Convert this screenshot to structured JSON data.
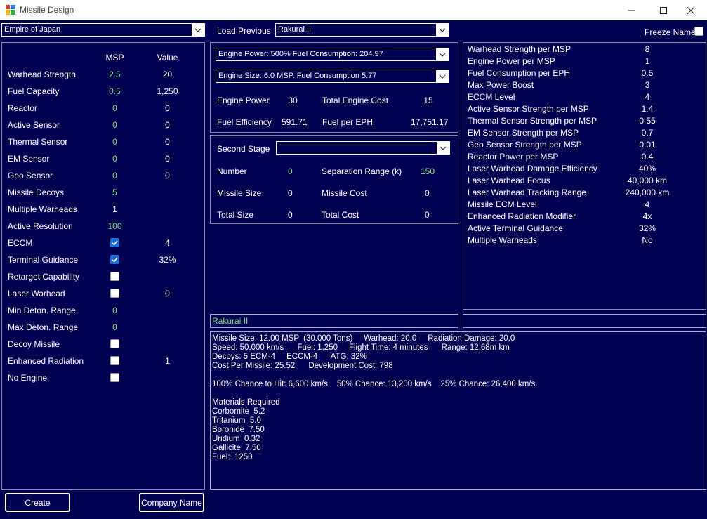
{
  "window": {
    "title": "Missile Design"
  },
  "top": {
    "empire": "Empire of Japan",
    "load_previous_label": "Load Previous",
    "load_previous_value": "Rakurai II",
    "freeze_name_label": "Freeze Name"
  },
  "left": {
    "col_msp": "MSP",
    "col_value": "Value",
    "rows": [
      {
        "label": "Warhead Strength",
        "msp": "2.5",
        "value": "20",
        "type": "num"
      },
      {
        "label": "Fuel Capacity",
        "msp": "0.5",
        "value": "1,250",
        "type": "num"
      },
      {
        "label": "Reactor",
        "msp": "0",
        "value": "0",
        "type": "num"
      },
      {
        "label": "Active Sensor",
        "msp": "0",
        "value": "0",
        "type": "num"
      },
      {
        "label": "Thermal Sensor",
        "msp": "0",
        "value": "0",
        "type": "num"
      },
      {
        "label": "EM Sensor",
        "msp": "0",
        "value": "0",
        "type": "num"
      },
      {
        "label": "Geo Sensor",
        "msp": "0",
        "value": "0",
        "type": "num"
      },
      {
        "label": "Missile Decoys",
        "msp": "5",
        "value": "",
        "type": "num"
      },
      {
        "label": "Multiple Warheads",
        "msp": "1",
        "value": "",
        "type": "white"
      },
      {
        "label": "Active Resolution",
        "msp": "100",
        "value": "",
        "type": "num"
      },
      {
        "label": "ECCM",
        "msp": "",
        "value": "4",
        "type": "check",
        "checked": true
      },
      {
        "label": "Terminal Guidance",
        "msp": "",
        "value": "32%",
        "type": "check",
        "checked": true
      },
      {
        "label": "Retarget Capability",
        "msp": "",
        "value": "",
        "type": "check",
        "checked": false
      },
      {
        "label": "Laser Warhead",
        "msp": "",
        "value": "0",
        "type": "check",
        "checked": false
      },
      {
        "label": "Min Deton. Range",
        "msp": "0",
        "value": "",
        "type": "num"
      },
      {
        "label": "Max Deton. Range",
        "msp": "0",
        "value": "",
        "type": "num"
      },
      {
        "label": "Decoy Missile",
        "msp": "",
        "value": "",
        "type": "check",
        "checked": false
      },
      {
        "label": "Enhanced Radiation",
        "msp": "",
        "value": "1",
        "type": "check",
        "checked": false
      },
      {
        "label": "No Engine",
        "msp": "",
        "value": "",
        "type": "check",
        "checked": false
      }
    ]
  },
  "engine": {
    "power_dropdown": "Engine Power: 500%    Fuel Consumption: 204.97",
    "size_dropdown": "Engine Size: 6.0 MSP.   Fuel Consumption 5.77",
    "engine_power_label": "Engine Power",
    "engine_power_value": "30",
    "total_engine_cost_label": "Total Engine Cost",
    "total_engine_cost_value": "15",
    "fuel_efficiency_label": "Fuel Efficiency",
    "fuel_efficiency_value": "591.71",
    "fuel_per_eph_label": "Fuel per EPH",
    "fuel_per_eph_value": "17,751.17"
  },
  "stage": {
    "second_stage_label": "Second Stage",
    "second_stage_value": "",
    "number_label": "Number",
    "number_value": "0",
    "separation_label": "Separation Range (k)",
    "separation_value": "150",
    "missile_size_label": "Missile Size",
    "missile_size_value": "0",
    "missile_cost_label": "Missile Cost",
    "missile_cost_value": "0",
    "total_size_label": "Total Size",
    "total_size_value": "0",
    "total_cost_label": "Total Cost",
    "total_cost_value": "0"
  },
  "tech": [
    {
      "label": "Warhead Strength per MSP",
      "value": "8"
    },
    {
      "label": "Engine Power per MSP",
      "value": "1"
    },
    {
      "label": "Fuel Consumption per EPH",
      "value": "0.5"
    },
    {
      "label": "Max Power Boost",
      "value": "3"
    },
    {
      "label": "ECCM Level",
      "value": "4"
    },
    {
      "label": "Active Sensor Strength per MSP",
      "value": "1.4"
    },
    {
      "label": "Thermal Sensor Strength per MSP",
      "value": "0.55"
    },
    {
      "label": "EM Sensor Strength per MSP",
      "value": "0.7"
    },
    {
      "label": "Geo Sensor Strength per MSP",
      "value": "0.01"
    },
    {
      "label": "Reactor Power per MSP",
      "value": "0.4"
    },
    {
      "label": "Laser Warhead Damage Efficiency",
      "value": "40%"
    },
    {
      "label": "Laser Warhead Focus",
      "value": "40,000 km"
    },
    {
      "label": "Laser Warhead Tracking Range",
      "value": "240,000 km"
    },
    {
      "label": "Missile ECM Level",
      "value": "4"
    },
    {
      "label": "Enhanced Radiation Modifier",
      "value": "4x"
    },
    {
      "label": "Active Terminal Guidance",
      "value": "32%"
    },
    {
      "label": "Multiple Warheads",
      "value": "No"
    }
  ],
  "name_field": "Rakurai II",
  "name_field_right": "",
  "summary": [
    "Missile Size: 12.00 MSP  (30.000 Tons)     Warhead: 20.0     Radiation Damage: 20.0",
    "Speed: 50,000 km/s      Fuel: 1,250     Flight Time: 4 minutes      Range: 12.68m km",
    "Decoys: 5 ECM-4     ECCM-4      ATG: 32%",
    "Cost Per Missile: 25.52      Development Cost: 798",
    "",
    "100% Chance to Hit: 6,600 km/s    50% Chance: 13,200 km/s    25% Chance: 26,400 km/s",
    "",
    "Materials Required",
    "Corbomite  5.2",
    "Tritanium  5.0",
    "Boronide  7.50",
    "Uridium  0.32",
    "Gallicite  7.50",
    "Fuel:  1250"
  ],
  "buttons": {
    "create": "Create",
    "company_name": "Company Name"
  },
  "colors": {
    "background": "#000050",
    "green_value": "#7fe57f",
    "checkbox_on": "#1c6ad6"
  }
}
